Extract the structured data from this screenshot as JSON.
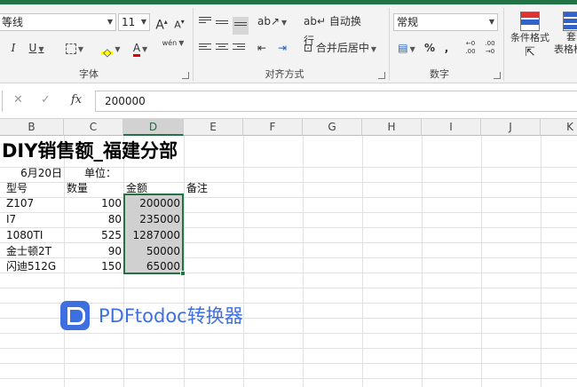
{
  "ribbon": {
    "font": {
      "font_name": "等线",
      "font_size": "11",
      "grow_label": "A",
      "shrink_label": "A",
      "italic_label": "I",
      "underline_label": "U",
      "font_color_label": "A",
      "phonetic_label": "wén",
      "group_label": "字体"
    },
    "alignment": {
      "wrap_label": "自动换行",
      "merge_label": "合并后居中",
      "group_label": "对齐方式"
    },
    "number": {
      "format_value": "常规",
      "percent_label": "%",
      "comma_label": ",",
      "inc_decimal_label": "←0 .00",
      "dec_decimal_label": ".00 →0",
      "group_label": "数字"
    },
    "styles": {
      "conditional_label": "条件格式",
      "table_label_1": "套",
      "table_label_2": "表格格"
    }
  },
  "formula_bar": {
    "cancel_label": "✕",
    "enter_label": "✓",
    "fx_label": "fx",
    "value": "200000"
  },
  "columns": [
    "B",
    "C",
    "D",
    "E",
    "F",
    "G",
    "H",
    "I",
    "J",
    "K"
  ],
  "active_column": "D",
  "sheet": {
    "title": "DIY销售额_福建分部",
    "date": "6月20日",
    "unit_label": "单位：",
    "headers": [
      "型号",
      "数量",
      "金额",
      "备注"
    ],
    "rows": [
      {
        "model": "Z107",
        "qty": "100",
        "amount": "200000"
      },
      {
        "model": "I7",
        "qty": "80",
        "amount": "235000"
      },
      {
        "model": "1080TI",
        "qty": "525",
        "amount": "1287000"
      },
      {
        "model": "金士顿2T",
        "qty": "90",
        "amount": "50000"
      },
      {
        "model": "闪迪512G",
        "qty": "150",
        "amount": "65000"
      }
    ]
  },
  "watermark": {
    "text": "PDFtodoc转换器"
  },
  "colors": {
    "accent": "#217346",
    "watermark": "#3e6fe0",
    "selection_fill": "#d0d0d0"
  }
}
